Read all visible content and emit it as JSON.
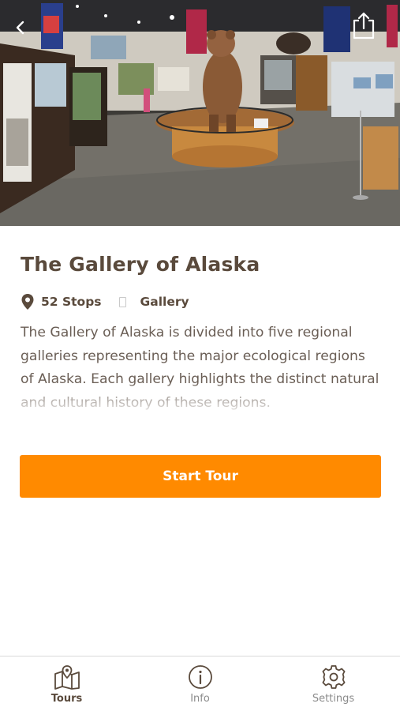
{
  "hero": {
    "back_icon": "chevron-left-icon",
    "share_icon": "share-icon"
  },
  "tour": {
    "title": "The Gallery of Alaska",
    "stops": "52 Stops",
    "category": "Gallery",
    "description": "The Gallery of Alaska is divided into five regional galleries representing the major ecological regions of Alaska. Each gallery highlights the distinct natural and cultural history of these regions."
  },
  "actions": {
    "start_label": "Start Tour",
    "accent_color": "#ff8a00"
  },
  "tabbar": {
    "tabs": [
      {
        "label": "Tours",
        "icon": "map-pin-icon",
        "active": true
      },
      {
        "label": "Info",
        "icon": "info-icon",
        "active": false
      },
      {
        "label": "Settings",
        "icon": "gear-icon",
        "active": false
      }
    ]
  }
}
